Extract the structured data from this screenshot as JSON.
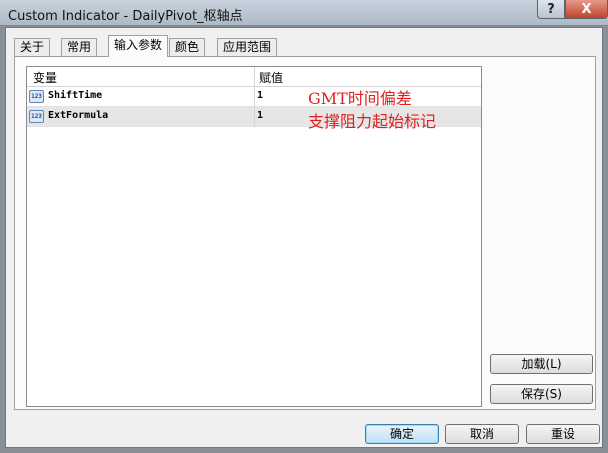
{
  "window": {
    "title": "Custom Indicator - DailyPivot_枢轴点",
    "help_glyph": "?",
    "close_glyph": "X"
  },
  "tabs": [
    {
      "label": "关于"
    },
    {
      "label": "常用"
    },
    {
      "label": "输入参数",
      "active": true
    },
    {
      "label": "颜色"
    },
    {
      "label": "应用范围"
    }
  ],
  "params": {
    "columns": {
      "variable": "变量",
      "value": "赋值"
    },
    "type_icon_text": "123",
    "rows": [
      {
        "name": "ShiftTime",
        "value": "1"
      },
      {
        "name": "ExtFormula",
        "value": "1"
      }
    ]
  },
  "annotations": [
    "GMT时间偏差",
    "支撑阻力起始标记"
  ],
  "side_buttons": {
    "load": "加载(L)",
    "save": "保存(S)"
  },
  "footer_buttons": {
    "ok": "确定",
    "cancel": "取消",
    "reset": "重设"
  },
  "colors": {
    "annotation": "#e11f1f",
    "default_button_border": "#3c7fb1"
  }
}
